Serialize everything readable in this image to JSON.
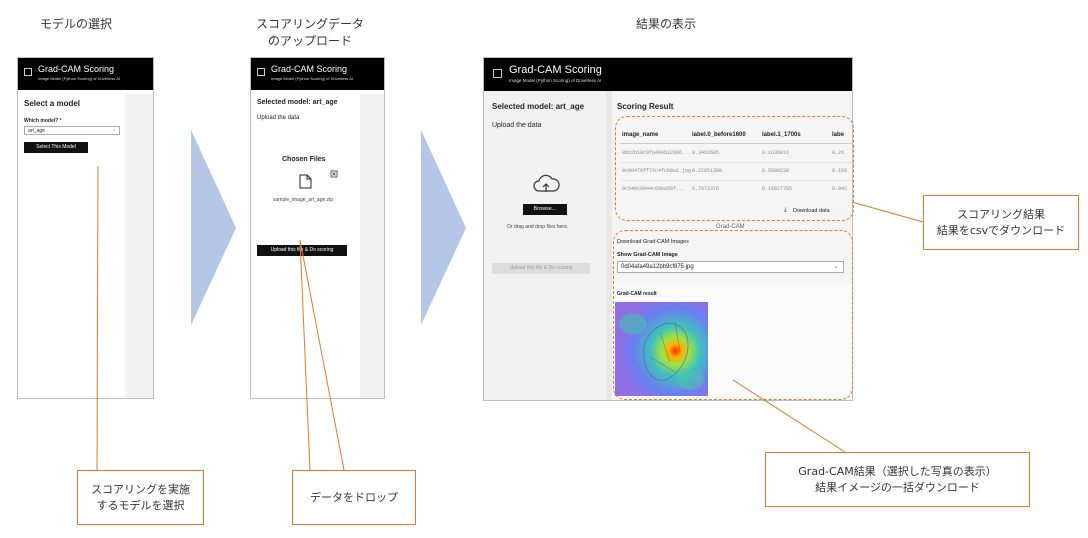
{
  "steps": {
    "step1_title": "モデルの選択",
    "step2_title_line1": "スコアリングデータ",
    "step2_title_line2": "のアップロード",
    "step3_title": "結果の表示"
  },
  "app": {
    "title": "Grad-CAM Scoring",
    "subtitle": "Image Model (Python Scoring) of Driverless AI"
  },
  "screen1": {
    "heading": "Select a model",
    "field_label": "Which model?",
    "required_mark": "*",
    "select_value": "art_age",
    "button": "Select This Model"
  },
  "screen2": {
    "selected_model": "Selected model: art_age",
    "upload_label": "Upload the data",
    "chosen_files": "Chosen Files",
    "file_name": "sample_image_art_age.zip",
    "button": "Upload this file & Do scoring"
  },
  "screen3": {
    "selected_model": "Selected model: art_age",
    "upload_label": "Upload the data",
    "browse": "Browse...",
    "drag_text": "Or drag and drop files here.",
    "upload_button": "Upload this file & Do scoring",
    "result_heading": "Scoring Result",
    "table": {
      "headers": [
        "image_name",
        "label.0_before1600",
        "label.1_1700s",
        "labe"
      ],
      "rows": [
        [
          "0bb2b10c9fa48e512006...",
          "0.3462605",
          "0.1636816",
          "0.26"
        ],
        [
          "0c0d479ff72c4fcb8a1.jpg",
          "0.22051388",
          "0.5980238",
          "0.158"
        ],
        [
          "0c540c9844c6dea58f...",
          "0.7872376",
          "0.15827785",
          "0.042"
        ]
      ]
    },
    "download_data": "Download data",
    "gradcam_frame_label": "Grad-CAM",
    "download_images": "Download Grad-CAM Images",
    "show_label": "Show Grad-CAM Image",
    "show_value": "0d04afa49a12bb9cf875.jpg",
    "result_label": "Grad-CAM result"
  },
  "callouts": {
    "c1_line1": "スコアリングを実施",
    "c1_line2": "するモデルを選択",
    "c2": "データをドロップ",
    "c3_line1": "スコアリング結果",
    "c3_line2": "結果をcsvでダウンロード",
    "c4_line1": "Grad-CAM結果（選択した写真の表示）",
    "c4_line2": "結果イメージの一括ダウンロード"
  },
  "colors": {
    "arrow": "#b3c6e6",
    "callout_line": "#e07a2e",
    "appbar": "#000000"
  }
}
